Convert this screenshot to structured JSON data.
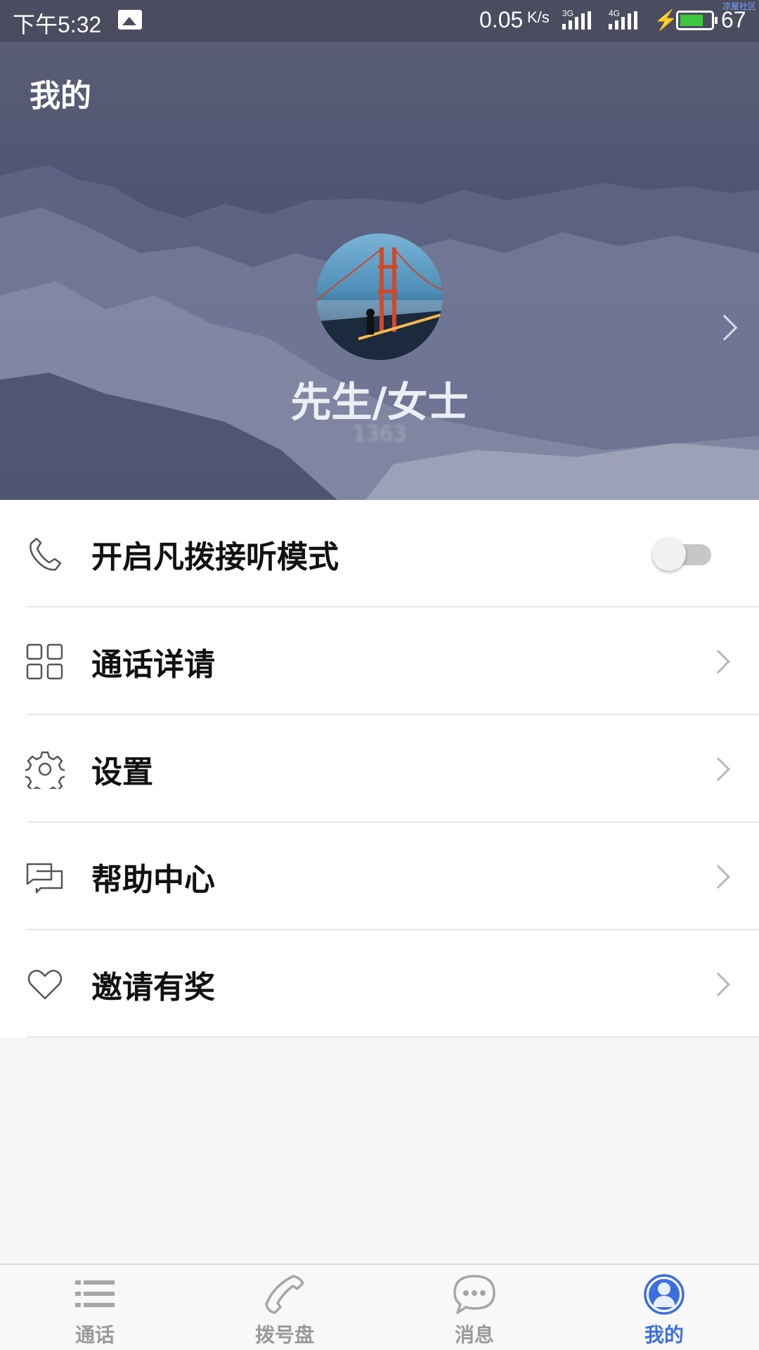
{
  "status_bar": {
    "time": "下午5:32",
    "net_speed": "0.05",
    "net_speed_unit": "K/s",
    "signal_1_tag": "3G",
    "signal_2_tag": "4G",
    "battery_percent": "67",
    "battery_level": 0.67,
    "watermark": "凉屋社区"
  },
  "header": {
    "title": "我的",
    "user_name": "先生/女士",
    "user_sub": "1363"
  },
  "menu": {
    "items": [
      {
        "label": "开启凡拨接听模式",
        "icon": "phone-handset-icon",
        "control": "toggle",
        "toggle_on": false
      },
      {
        "label": "通话详请",
        "icon": "grid-icon",
        "control": "chevron"
      },
      {
        "label": "设置",
        "icon": "gear-icon",
        "control": "chevron"
      },
      {
        "label": "帮助中心",
        "icon": "chat-bubbles-icon",
        "control": "chevron"
      },
      {
        "label": "邀请有奖",
        "icon": "heart-icon",
        "control": "chevron"
      }
    ]
  },
  "bottom_nav": {
    "active_color": "#3b6fe0",
    "inactive_color": "#9a9a9a",
    "items": [
      {
        "label": "通话",
        "icon": "list-icon",
        "active": false
      },
      {
        "label": "拨号盘",
        "icon": "phone-icon",
        "active": false
      },
      {
        "label": "消息",
        "icon": "message-icon",
        "active": false
      },
      {
        "label": "我的",
        "icon": "profile-icon",
        "active": true
      }
    ]
  }
}
